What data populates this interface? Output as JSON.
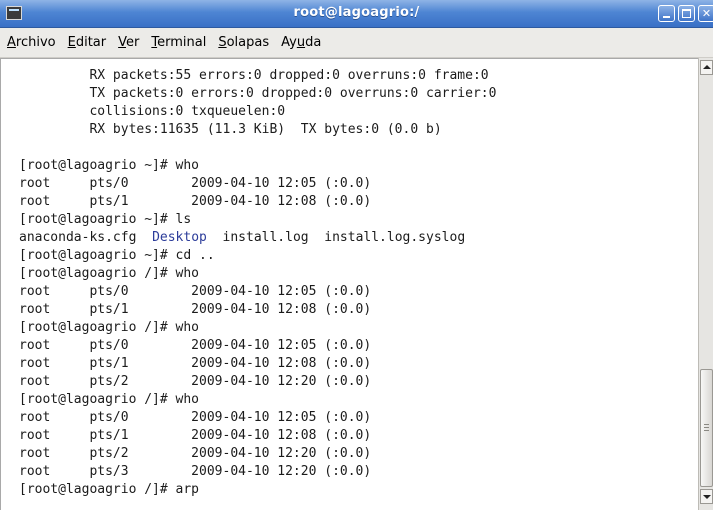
{
  "window": {
    "title": "root@lagoagrio:/"
  },
  "menu": {
    "items": [
      {
        "key": "A",
        "rest": "rchivo"
      },
      {
        "key": "E",
        "rest": "ditar"
      },
      {
        "key": "V",
        "rest": "er"
      },
      {
        "key": "T",
        "rest": "erminal"
      },
      {
        "key": "S",
        "rest": "olapas"
      },
      {
        "pre": "Ay",
        "key": "u",
        "rest": "da"
      }
    ]
  },
  "terminal": {
    "lines": [
      "         RX packets:55 errors:0 dropped:0 overruns:0 frame:0",
      "         TX packets:0 errors:0 dropped:0 overruns:0 carrier:0",
      "         collisions:0 txqueuelen:0",
      "         RX bytes:11635 (11.3 KiB)  TX bytes:0 (0.0 b)",
      "",
      "[root@lagoagrio ~]# who",
      "root     pts/0        2009-04-10 12:05 (:0.0)",
      "root     pts/1        2009-04-10 12:08 (:0.0)",
      "[root@lagoagrio ~]# ls",
      "",
      "[root@lagoagrio ~]# cd ..",
      "[root@lagoagrio /]# who",
      "root     pts/0        2009-04-10 12:05 (:0.0)",
      "root     pts/1        2009-04-10 12:08 (:0.0)",
      "[root@lagoagrio /]# who",
      "root     pts/0        2009-04-10 12:05 (:0.0)",
      "root     pts/1        2009-04-10 12:08 (:0.0)",
      "root     pts/2        2009-04-10 12:20 (:0.0)",
      "[root@lagoagrio /]# who",
      "root     pts/0        2009-04-10 12:05 (:0.0)",
      "root     pts/1        2009-04-10 12:08 (:0.0)",
      "root     pts/2        2009-04-10 12:20 (:0.0)",
      "root     pts/3        2009-04-10 12:20 (:0.0)",
      "[root@lagoagrio /]# arp"
    ],
    "ls_output": {
      "before": "anaconda-ks.cfg  ",
      "dir": "Desktop",
      "after": "  install.log  install.log.syslog"
    },
    "colors": {
      "text": "#1b1b1b",
      "directory": "#2c3c9a",
      "background": "#ffffff"
    }
  },
  "icons": {
    "app": "terminal-icon",
    "minimize": "minimize-icon",
    "maximize": "maximize-icon",
    "close": "close-icon"
  },
  "scrollbar": {
    "position_fraction": 0.9
  }
}
